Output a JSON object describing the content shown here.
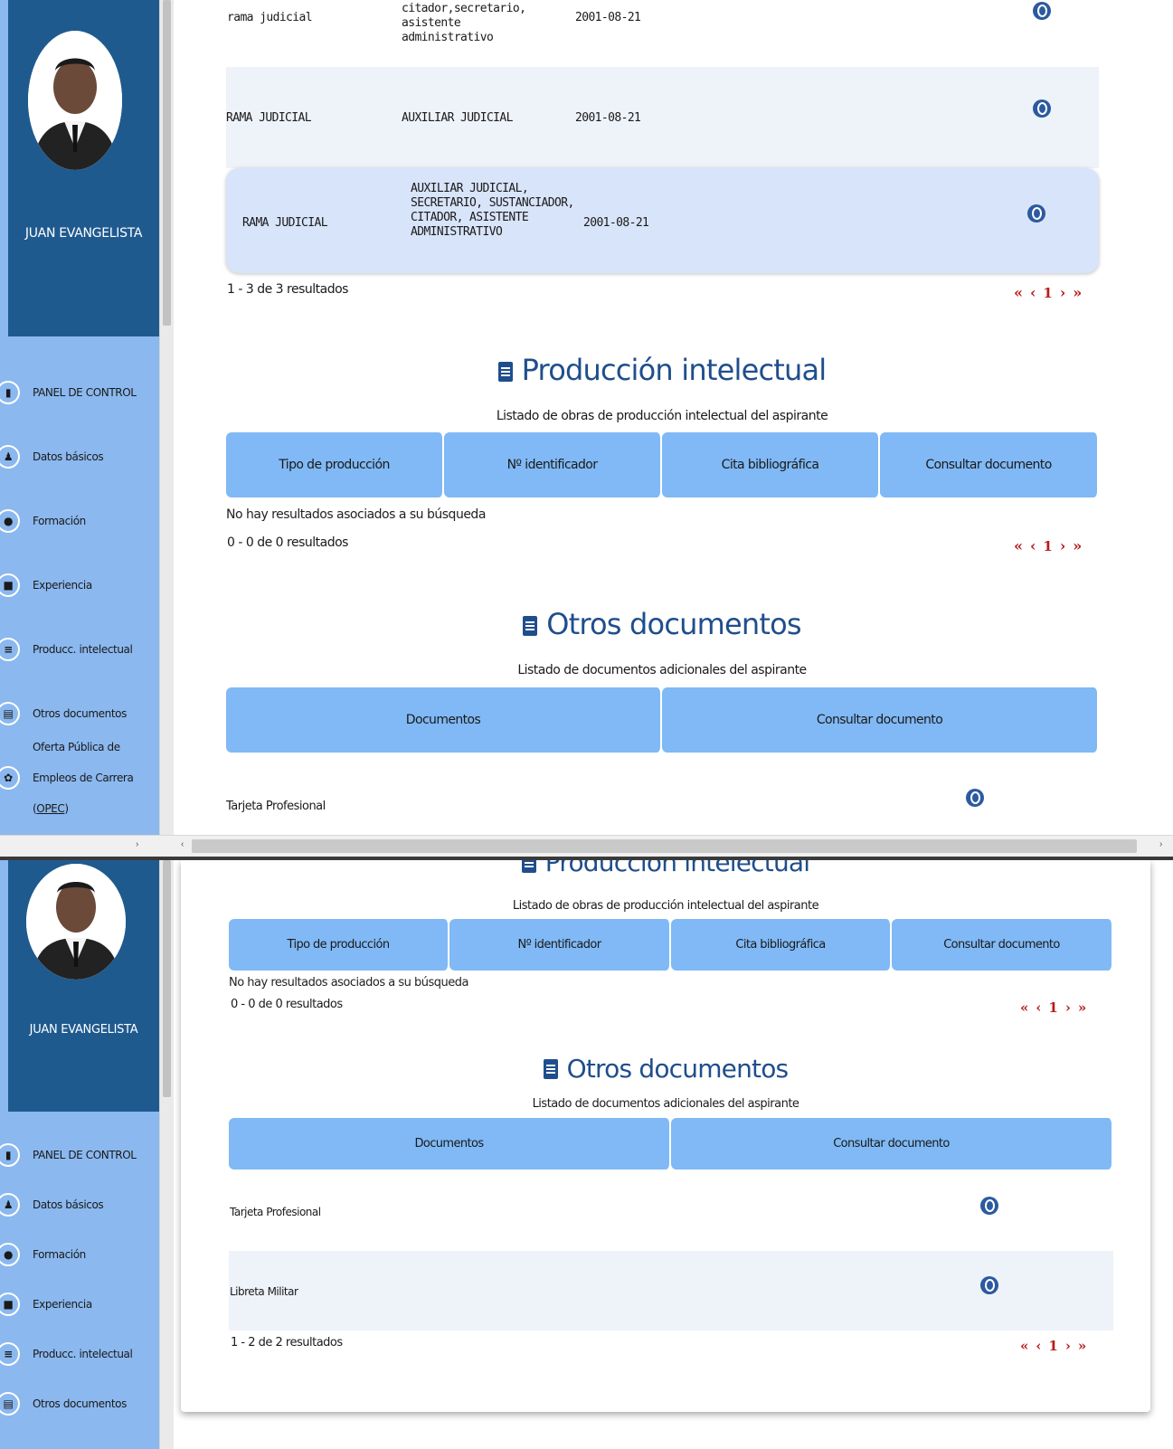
{
  "user": {
    "name": "JUAN EVANGELISTA",
    "photo": "user-photo"
  },
  "menu": [
    {
      "label": "PANEL DE CONTROL",
      "icon": "dashboard-icon"
    },
    {
      "label": "Datos básicos",
      "icon": "person-icon"
    },
    {
      "label": "Formación",
      "icon": "graduation-icon"
    },
    {
      "label": "Experiencia",
      "icon": "briefcase-icon"
    },
    {
      "label": "Producc. intelectual",
      "icon": "book-icon"
    },
    {
      "label": "Otros documentos",
      "icon": "file-icon"
    },
    {
      "label_line1": "Oferta Pública de",
      "label_line2_prefix": "Empleos de Carrera (",
      "label_line2_link": "OPEC",
      "label_line2_suffix": ")",
      "icon": "briefcase-gear-icon"
    }
  ],
  "experience": {
    "rows": [
      {
        "entity": "rama judicial",
        "position": "citador,secretario, asistente administrativo",
        "date": "2001-08-21"
      },
      {
        "entity": "RAMA JUDICIAL",
        "position": "AUXILIAR JUDICIAL",
        "date": "2001-08-21"
      },
      {
        "entity": "RAMA JUDICIAL",
        "position": "AUXILIAR JUDICIAL, SECRETARIO, SUSTANCIADOR, CITADOR, ASISTENTE ADMINISTRATIVO",
        "date": "2001-08-21"
      }
    ],
    "results": "1 - 3 de 3 resultados"
  },
  "pager": {
    "first": "«",
    "prev": "‹",
    "page": "1",
    "next": "›",
    "last": "»"
  },
  "production": {
    "title": "Producción intelectual",
    "subtitle": "Listado de obras de producción intelectual del aspirante",
    "columns": [
      "Tipo de producción",
      "Nº identificador",
      "Cita bibliográfica",
      "Consultar documento"
    ],
    "empty": "No hay resultados asociados a su búsqueda",
    "results": "0 - 0 de 0 resultados"
  },
  "documents": {
    "title": "Otros documentos",
    "subtitle": "Listado de documentos adicionales del aspirante",
    "columns": [
      "Documentos",
      "Consultar documento"
    ],
    "rows": [
      "Tarjeta Profesional",
      "Libreta Militar"
    ],
    "results": "1 - 2 de 2 resultados"
  },
  "colors": {
    "sidebar_dark": "#1f5a8f",
    "sidebar_light": "#8bb8ef",
    "header_blue": "#80b9f5",
    "pager_red": "#b81c1c",
    "title_blue": "#1f4e8c"
  }
}
